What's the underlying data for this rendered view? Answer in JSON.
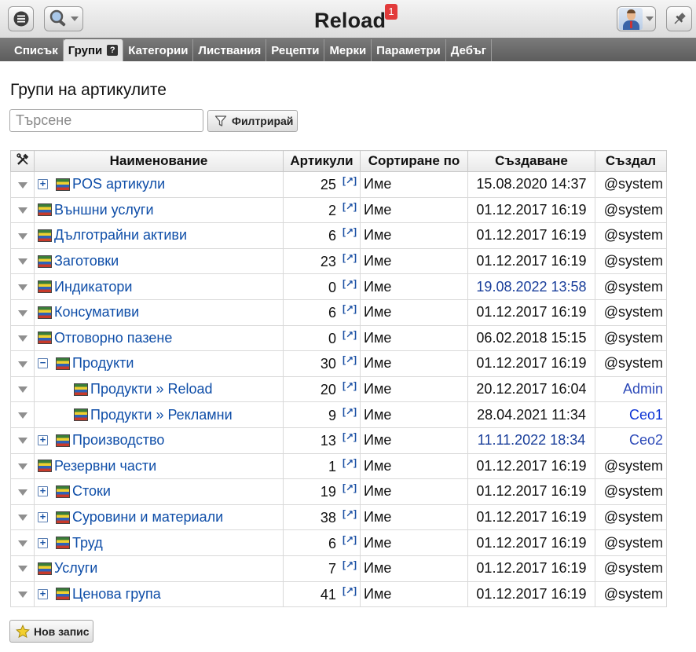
{
  "app": {
    "title": "Reload",
    "notification_count": "1"
  },
  "tabs": [
    {
      "label": "Списък"
    },
    {
      "label": "Групи",
      "active": true
    },
    {
      "label": "Категории"
    },
    {
      "label": "Листвания"
    },
    {
      "label": "Рецепти"
    },
    {
      "label": "Мерки"
    },
    {
      "label": "Параметри"
    },
    {
      "label": "Дебъг"
    }
  ],
  "page": {
    "title": "Групи на артикулите"
  },
  "search": {
    "placeholder": "Търсене",
    "value": ""
  },
  "filter_button": {
    "label": "Филтрирай"
  },
  "table": {
    "columns": {
      "name": "Наименование",
      "count": "Артикули",
      "sort": "Сортиране по",
      "created": "Създаване",
      "author": "Създал"
    },
    "rows": [
      {
        "name": "POS артикули",
        "count": "25",
        "sort": "Име",
        "created": "15.08.2020 14:37",
        "author": "@system",
        "expander": "plus",
        "indent": 0
      },
      {
        "name": "Външни услуги",
        "count": "2",
        "sort": "Име",
        "created": "01.12.2017 16:19",
        "author": "@system",
        "expander": "none",
        "indent": 0
      },
      {
        "name": "Дълготрайни активи",
        "count": "6",
        "sort": "Име",
        "created": "01.12.2017 16:19",
        "author": "@system",
        "expander": "none",
        "indent": 0
      },
      {
        "name": "Заготовки",
        "count": "23",
        "sort": "Име",
        "created": "01.12.2017 16:19",
        "author": "@system",
        "expander": "none",
        "indent": 0
      },
      {
        "name": "Индикатори",
        "count": "0",
        "sort": "Име",
        "created": "19.08.2022 13:58",
        "author": "@system",
        "expander": "none",
        "indent": 0,
        "date_style": "blue"
      },
      {
        "name": "Консумативи",
        "count": "6",
        "sort": "Име",
        "created": "01.12.2017 16:19",
        "author": "@system",
        "expander": "none",
        "indent": 0
      },
      {
        "name": "Отговорно пазене",
        "count": "0",
        "sort": "Име",
        "created": "06.02.2018 15:15",
        "author": "@system",
        "expander": "none",
        "indent": 0
      },
      {
        "name": "Продукти",
        "count": "30",
        "sort": "Име",
        "created": "01.12.2017 16:19",
        "author": "@system",
        "expander": "minus",
        "indent": 0
      },
      {
        "name": "Продукти » Reload",
        "count": "20",
        "sort": "Име",
        "created": "20.12.2017 16:04",
        "author": "Admin",
        "expander": "none",
        "indent": 1,
        "author_style": "blue"
      },
      {
        "name": "Продукти » Рекламни",
        "count": "9",
        "sort": "Име",
        "created": "28.04.2021 11:34",
        "author": "Ceo1",
        "expander": "none",
        "indent": 1,
        "author_style": "strong-blue"
      },
      {
        "name": "Производство",
        "count": "13",
        "sort": "Име",
        "created": "11.11.2022 18:34",
        "author": "Ceo2",
        "expander": "plus",
        "indent": 0,
        "date_style": "blue",
        "author_style": "blue"
      },
      {
        "name": "Резервни части",
        "count": "1",
        "sort": "Име",
        "created": "01.12.2017 16:19",
        "author": "@system",
        "expander": "none",
        "indent": 0
      },
      {
        "name": "Стоки",
        "count": "19",
        "sort": "Име",
        "created": "01.12.2017 16:19",
        "author": "@system",
        "expander": "plus",
        "indent": 0
      },
      {
        "name": "Суровини и материали",
        "count": "38",
        "sort": "Име",
        "created": "01.12.2017 16:19",
        "author": "@system",
        "expander": "plus",
        "indent": 0
      },
      {
        "name": "Труд",
        "count": "6",
        "sort": "Име",
        "created": "01.12.2017 16:19",
        "author": "@system",
        "expander": "plus",
        "indent": 0
      },
      {
        "name": "Услуги",
        "count": "7",
        "sort": "Име",
        "created": "01.12.2017 16:19",
        "author": "@system",
        "expander": "none",
        "indent": 0
      },
      {
        "name": "Ценова група",
        "count": "41",
        "sort": "Име",
        "created": "01.12.2017 16:19",
        "author": "@system",
        "expander": "plus",
        "indent": 0
      }
    ]
  },
  "new_record_button": {
    "label": "Нов запис"
  },
  "icons": {
    "menu": "hamburger-menu-icon",
    "search": "magnifier-icon",
    "pin": "pin-icon",
    "tools": "tools-icon",
    "row_menu": "row-menu-caret-icon",
    "expand": "expand-plus-icon",
    "collapse": "collapse-minus-icon",
    "group": "group-folder-icon",
    "external": "external-link-icon",
    "filter": "funnel-icon",
    "new": "star-icon"
  },
  "colors": {
    "link": "#0f4ea8",
    "tab_bar": "#6b6b6b",
    "badge": "#e23b3b"
  }
}
